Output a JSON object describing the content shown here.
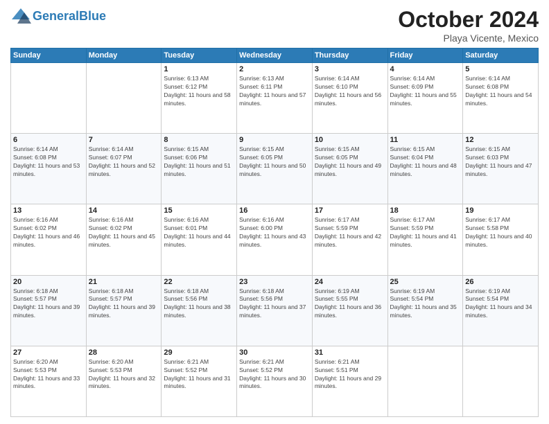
{
  "header": {
    "logo_line1": "General",
    "logo_line2": "Blue",
    "month_title": "October 2024",
    "location": "Playa Vicente, Mexico"
  },
  "days_of_week": [
    "Sunday",
    "Monday",
    "Tuesday",
    "Wednesday",
    "Thursday",
    "Friday",
    "Saturday"
  ],
  "weeks": [
    [
      {
        "day": "",
        "info": ""
      },
      {
        "day": "",
        "info": ""
      },
      {
        "day": "1",
        "info": "Sunrise: 6:13 AM\nSunset: 6:12 PM\nDaylight: 11 hours and 58 minutes."
      },
      {
        "day": "2",
        "info": "Sunrise: 6:13 AM\nSunset: 6:11 PM\nDaylight: 11 hours and 57 minutes."
      },
      {
        "day": "3",
        "info": "Sunrise: 6:14 AM\nSunset: 6:10 PM\nDaylight: 11 hours and 56 minutes."
      },
      {
        "day": "4",
        "info": "Sunrise: 6:14 AM\nSunset: 6:09 PM\nDaylight: 11 hours and 55 minutes."
      },
      {
        "day": "5",
        "info": "Sunrise: 6:14 AM\nSunset: 6:08 PM\nDaylight: 11 hours and 54 minutes."
      }
    ],
    [
      {
        "day": "6",
        "info": "Sunrise: 6:14 AM\nSunset: 6:08 PM\nDaylight: 11 hours and 53 minutes."
      },
      {
        "day": "7",
        "info": "Sunrise: 6:14 AM\nSunset: 6:07 PM\nDaylight: 11 hours and 52 minutes."
      },
      {
        "day": "8",
        "info": "Sunrise: 6:15 AM\nSunset: 6:06 PM\nDaylight: 11 hours and 51 minutes."
      },
      {
        "day": "9",
        "info": "Sunrise: 6:15 AM\nSunset: 6:05 PM\nDaylight: 11 hours and 50 minutes."
      },
      {
        "day": "10",
        "info": "Sunrise: 6:15 AM\nSunset: 6:05 PM\nDaylight: 11 hours and 49 minutes."
      },
      {
        "day": "11",
        "info": "Sunrise: 6:15 AM\nSunset: 6:04 PM\nDaylight: 11 hours and 48 minutes."
      },
      {
        "day": "12",
        "info": "Sunrise: 6:15 AM\nSunset: 6:03 PM\nDaylight: 11 hours and 47 minutes."
      }
    ],
    [
      {
        "day": "13",
        "info": "Sunrise: 6:16 AM\nSunset: 6:02 PM\nDaylight: 11 hours and 46 minutes."
      },
      {
        "day": "14",
        "info": "Sunrise: 6:16 AM\nSunset: 6:02 PM\nDaylight: 11 hours and 45 minutes."
      },
      {
        "day": "15",
        "info": "Sunrise: 6:16 AM\nSunset: 6:01 PM\nDaylight: 11 hours and 44 minutes."
      },
      {
        "day": "16",
        "info": "Sunrise: 6:16 AM\nSunset: 6:00 PM\nDaylight: 11 hours and 43 minutes."
      },
      {
        "day": "17",
        "info": "Sunrise: 6:17 AM\nSunset: 5:59 PM\nDaylight: 11 hours and 42 minutes."
      },
      {
        "day": "18",
        "info": "Sunrise: 6:17 AM\nSunset: 5:59 PM\nDaylight: 11 hours and 41 minutes."
      },
      {
        "day": "19",
        "info": "Sunrise: 6:17 AM\nSunset: 5:58 PM\nDaylight: 11 hours and 40 minutes."
      }
    ],
    [
      {
        "day": "20",
        "info": "Sunrise: 6:18 AM\nSunset: 5:57 PM\nDaylight: 11 hours and 39 minutes."
      },
      {
        "day": "21",
        "info": "Sunrise: 6:18 AM\nSunset: 5:57 PM\nDaylight: 11 hours and 39 minutes."
      },
      {
        "day": "22",
        "info": "Sunrise: 6:18 AM\nSunset: 5:56 PM\nDaylight: 11 hours and 38 minutes."
      },
      {
        "day": "23",
        "info": "Sunrise: 6:18 AM\nSunset: 5:56 PM\nDaylight: 11 hours and 37 minutes."
      },
      {
        "day": "24",
        "info": "Sunrise: 6:19 AM\nSunset: 5:55 PM\nDaylight: 11 hours and 36 minutes."
      },
      {
        "day": "25",
        "info": "Sunrise: 6:19 AM\nSunset: 5:54 PM\nDaylight: 11 hours and 35 minutes."
      },
      {
        "day": "26",
        "info": "Sunrise: 6:19 AM\nSunset: 5:54 PM\nDaylight: 11 hours and 34 minutes."
      }
    ],
    [
      {
        "day": "27",
        "info": "Sunrise: 6:20 AM\nSunset: 5:53 PM\nDaylight: 11 hours and 33 minutes."
      },
      {
        "day": "28",
        "info": "Sunrise: 6:20 AM\nSunset: 5:53 PM\nDaylight: 11 hours and 32 minutes."
      },
      {
        "day": "29",
        "info": "Sunrise: 6:21 AM\nSunset: 5:52 PM\nDaylight: 11 hours and 31 minutes."
      },
      {
        "day": "30",
        "info": "Sunrise: 6:21 AM\nSunset: 5:52 PM\nDaylight: 11 hours and 30 minutes."
      },
      {
        "day": "31",
        "info": "Sunrise: 6:21 AM\nSunset: 5:51 PM\nDaylight: 11 hours and 29 minutes."
      },
      {
        "day": "",
        "info": ""
      },
      {
        "day": "",
        "info": ""
      }
    ]
  ]
}
